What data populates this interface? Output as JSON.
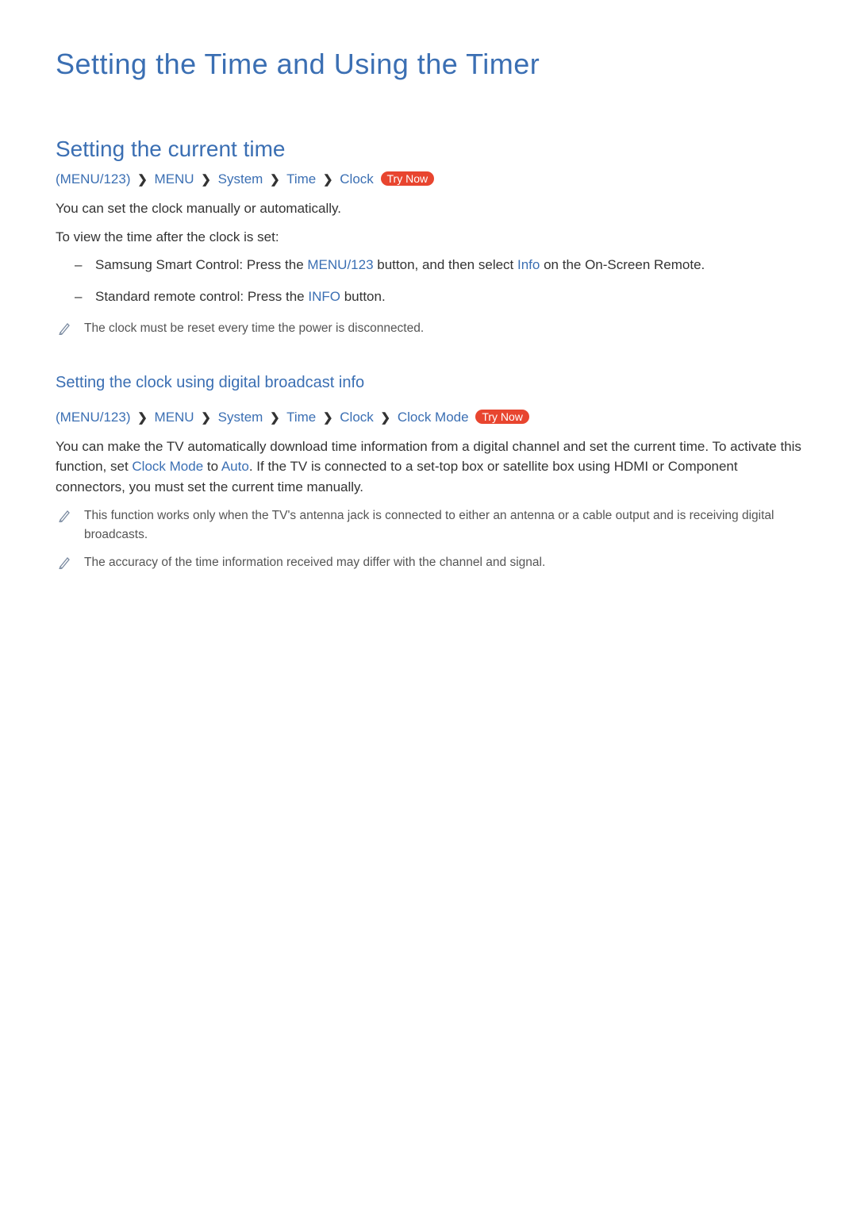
{
  "title": "Setting the Time and Using the Timer",
  "section1": {
    "heading": "Setting the current time",
    "bc": {
      "menu123": "MENU/123",
      "menu": "MENU",
      "system": "System",
      "time": "Time",
      "clock": "Clock",
      "tryNow": "Try Now"
    },
    "p1": "You can set the clock manually or automatically.",
    "p2": "To view the time after the clock is set:",
    "bullets": [
      {
        "pre": "Samsung Smart Control: Press the ",
        "link1": "MENU/123",
        "mid": " button, and then select ",
        "link2": "Info",
        "post": " on the On-Screen Remote."
      },
      {
        "pre": "Standard remote control: Press the ",
        "link1": "INFO",
        "post": " button."
      }
    ],
    "note": "The clock must be reset every time the power is disconnected."
  },
  "section2": {
    "heading": "Setting the clock using digital broadcast info",
    "bc": {
      "menu123": "MENU/123",
      "menu": "MENU",
      "system": "System",
      "time": "Time",
      "clock": "Clock",
      "clockMode": "Clock Mode",
      "tryNow": "Try Now"
    },
    "p1a": "You can make the TV automatically download time information from a digital channel and set the current time. To activate this function, set ",
    "p1_link1": "Clock Mode",
    "p1b": " to ",
    "p1_link2": "Auto",
    "p1c": ". If the TV is connected to a set-top box or satellite box using HDMI or Component connectors, you must set the current time manually.",
    "note1": "This function works only when the TV's antenna jack is connected to either an antenna or a cable output and is receiving digital broadcasts.",
    "note2": "The accuracy of the time information received may differ with the channel and signal."
  }
}
